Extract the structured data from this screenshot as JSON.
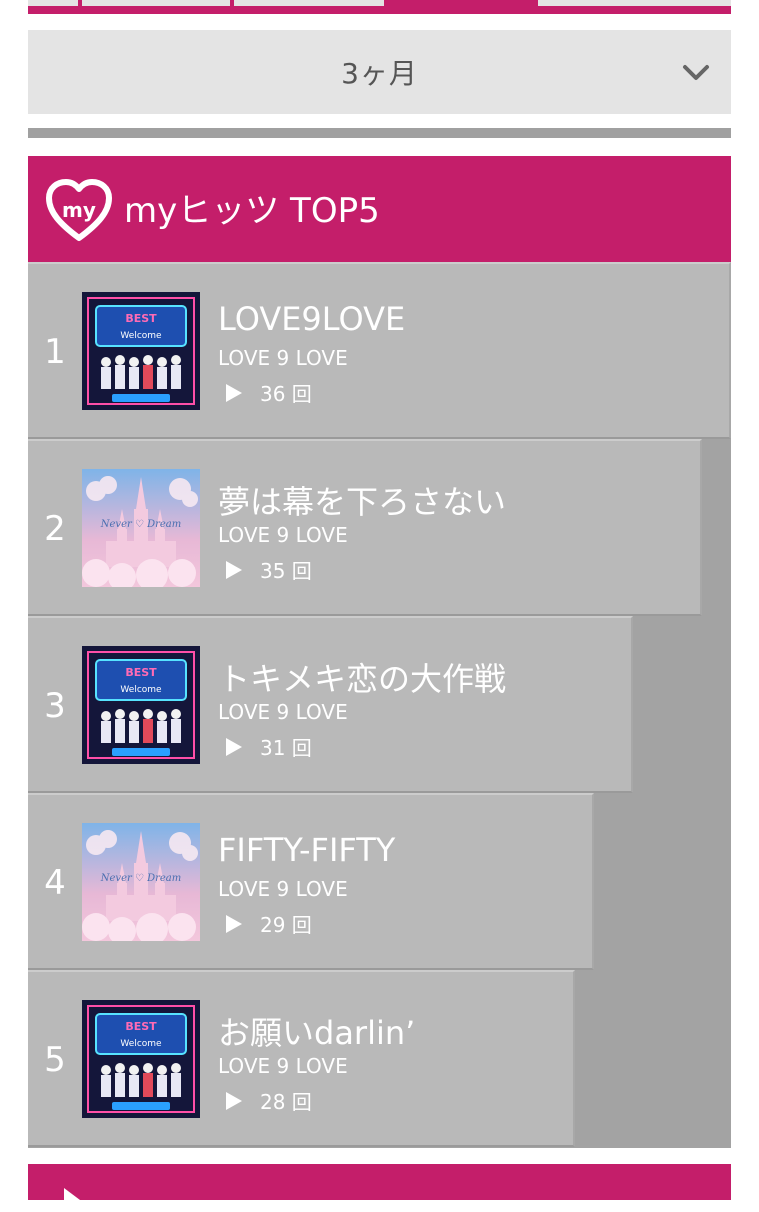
{
  "period": {
    "selected": "3ヶ月",
    "icon": "chevron-down-icon"
  },
  "header": {
    "title": "myヒッツ TOP5",
    "logo_text": "my",
    "brand_color": "#c41e6a"
  },
  "ranking": [
    {
      "rank": "1",
      "song": "LOVE9LOVE",
      "artist": "LOVE 9 LOVE",
      "plays": "36 回",
      "jacket": "best-album-jacket",
      "count": 36
    },
    {
      "rank": "2",
      "song": "夢は幕を下ろさない",
      "artist": "LOVE 9 LOVE",
      "plays": "35 回",
      "jacket": "castle-jacket",
      "count": 35
    },
    {
      "rank": "3",
      "song": "トキメキ恋の大作戦",
      "artist": "LOVE 9 LOVE",
      "plays": "31 回",
      "jacket": "best-album-jacket",
      "count": 31
    },
    {
      "rank": "4",
      "song": "FIFTY-FIFTY",
      "artist": "LOVE 9 LOVE",
      "plays": "29 回",
      "jacket": "castle-jacket",
      "count": 29
    },
    {
      "rank": "5",
      "song": "お願いdarlin’",
      "artist": "LOVE 9 LOVE",
      "plays": "28 回",
      "jacket": "best-album-jacket",
      "count": 28
    }
  ]
}
